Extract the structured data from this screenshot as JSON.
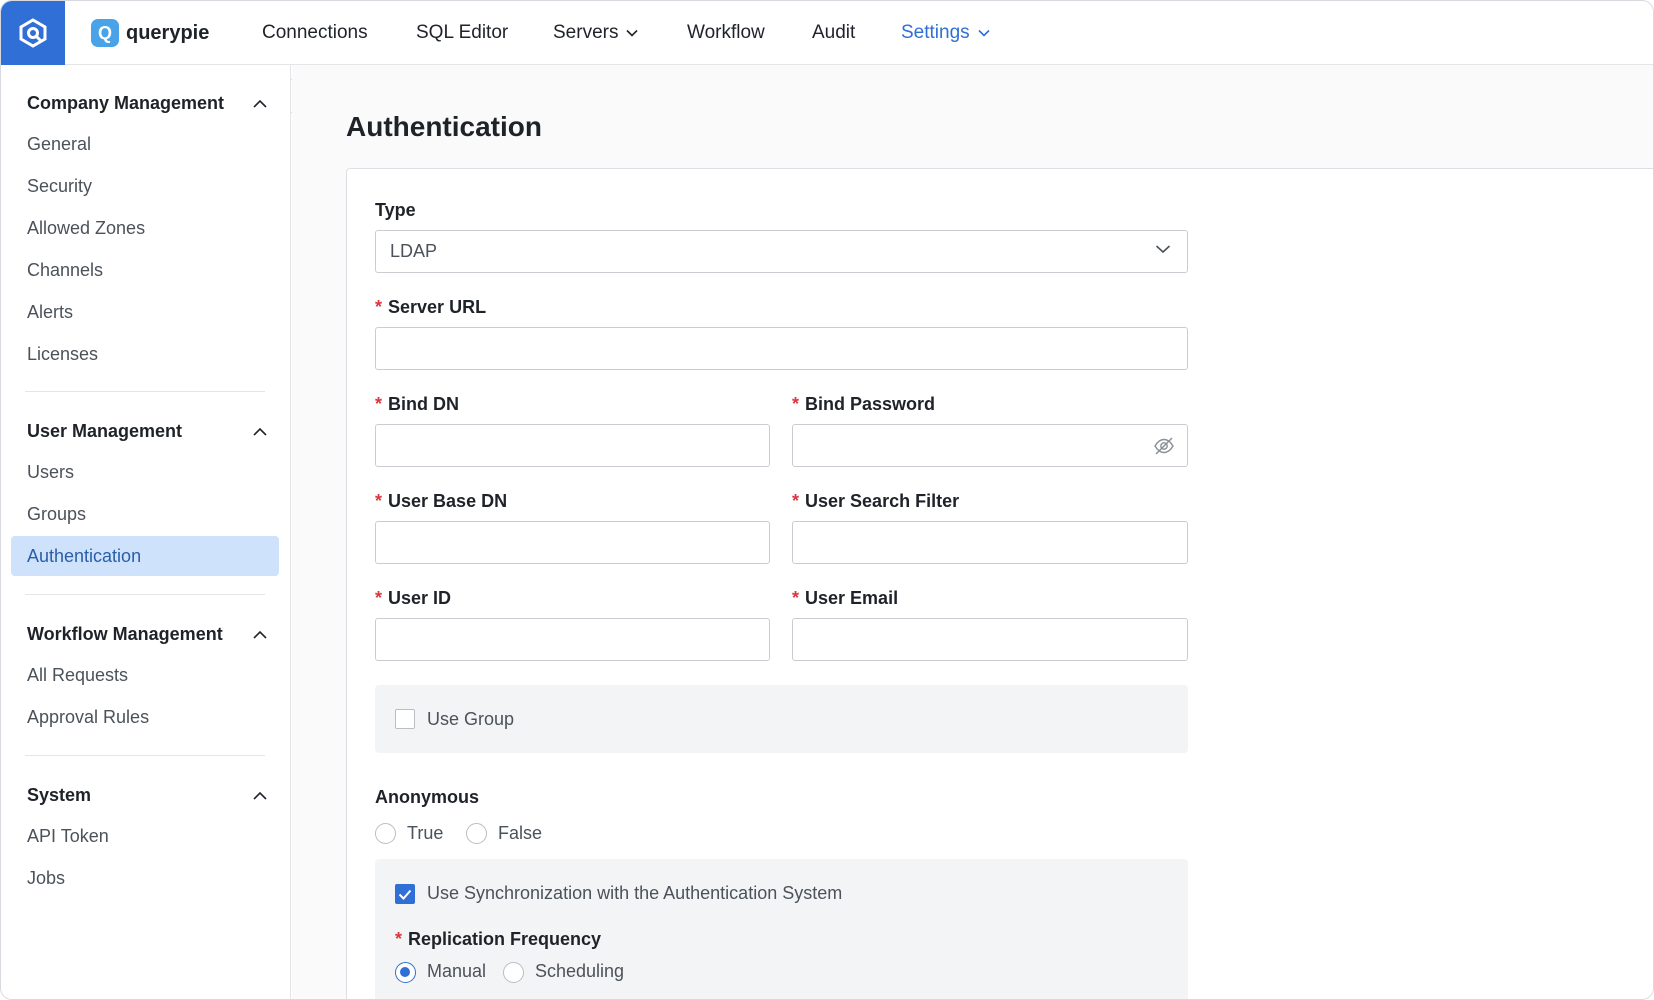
{
  "nav": {
    "brand": "querypie",
    "brand_letter": "Q",
    "items": [
      {
        "label": "Connections"
      },
      {
        "label": "SQL Editor"
      },
      {
        "label": "Servers"
      },
      {
        "label": "Workflow"
      },
      {
        "label": "Audit"
      },
      {
        "label": "Settings"
      }
    ]
  },
  "sidebar": {
    "company": {
      "title": "Company Management",
      "items": [
        "General",
        "Security",
        "Allowed Zones",
        "Channels",
        "Alerts",
        "Licenses"
      ]
    },
    "user": {
      "title": "User Management",
      "items": [
        "Users",
        "Groups",
        "Authentication"
      ]
    },
    "workflow": {
      "title": "Workflow Management",
      "items": [
        "All Requests",
        "Approval Rules"
      ]
    },
    "system": {
      "title": "System",
      "items": [
        "API Token",
        "Jobs"
      ]
    }
  },
  "main": {
    "title": "Authentication",
    "form": {
      "type_label": "Type",
      "type_value": "LDAP",
      "server_url_label": "Server URL",
      "bind_dn_label": "Bind DN",
      "bind_password_label": "Bind Password",
      "user_base_dn_label": "User Base DN",
      "user_search_filter_label": "User Search Filter",
      "user_id_label": "User ID",
      "user_email_label": "User Email",
      "use_group_label": "Use Group",
      "anonymous_label": "Anonymous",
      "anonymous_true": "True",
      "anonymous_false": "False",
      "sync_label": "Use Synchronization with the Authentication System",
      "replication_label": "Replication Frequency",
      "replication_manual": "Manual",
      "replication_scheduling": "Scheduling"
    }
  },
  "colors": {
    "accent": "#2f6fd6",
    "active_bg": "#cfe2fb",
    "required": "#d9363e"
  }
}
